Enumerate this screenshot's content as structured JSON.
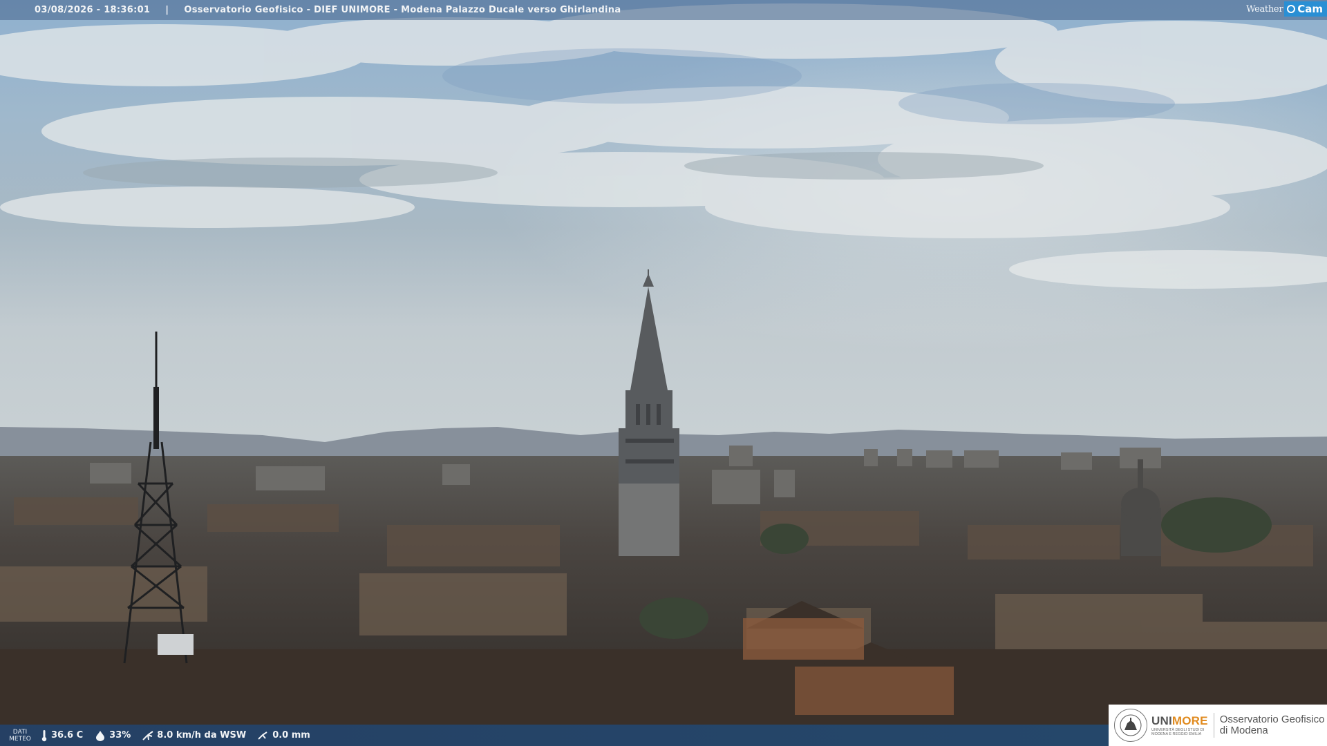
{
  "overlay": {
    "timestamp": "03/08/2026 - 18:36:01",
    "separator": "|",
    "title": "Osservatorio Geofisico - DIEF UNIMORE - Modena Palazzo Ducale verso Ghirlandina",
    "brand_weather": "Weather",
    "brand_cam": "Cam"
  },
  "meteo": {
    "label_line1": "DATI",
    "label_line2": "METEO",
    "temperature": "36.6 C",
    "humidity": "33%",
    "wind": "8.0 km/h da WSW",
    "rain": "0.0 mm",
    "icons": [
      "thermometer-icon",
      "humidity-drop-icon",
      "wind-icon",
      "rain-gauge-icon"
    ]
  },
  "logo": {
    "uni_prefix": "UNI",
    "uni_suffix": "MORE",
    "uni_subtitle": "UNIVERSITÀ DEGLI STUDI DI MODENA E REGGIO EMILIA",
    "obs_line1": "Osservatorio Geofisico",
    "obs_line2": "di Modena"
  },
  "colors": {
    "top_bar": "#46648c",
    "bottom_bar": "#1e4678",
    "brand_accent": "#2a8fd4",
    "unimore_orange": "#e08a1e",
    "sky_blue": "#8fb4d8",
    "haze": "#c9d3d8",
    "rooftops": "#3d3631"
  }
}
